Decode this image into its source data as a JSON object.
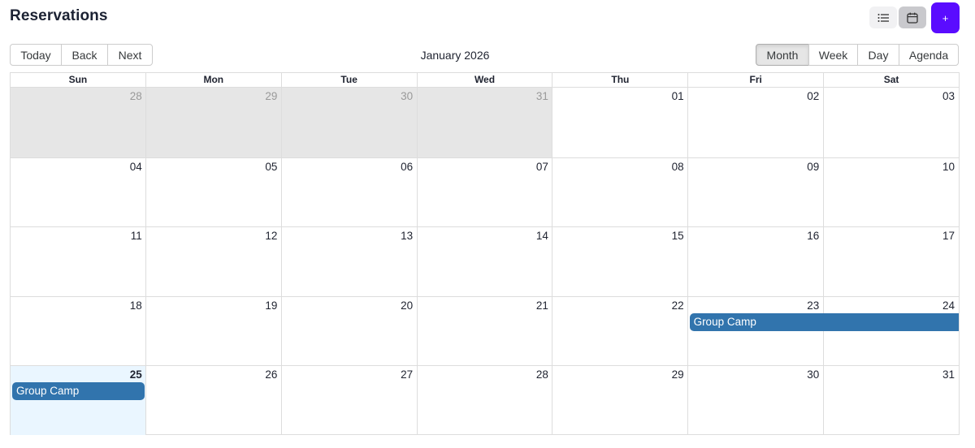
{
  "header": {
    "title": "Reservations",
    "list_view_icon": "list-icon",
    "calendar_view_icon": "calendar-icon",
    "add_label": "+"
  },
  "toolbar": {
    "nav": [
      "Today",
      "Back",
      "Next"
    ],
    "label": "January 2026",
    "views": [
      "Month",
      "Week",
      "Day",
      "Agenda"
    ],
    "active_view": "Month"
  },
  "calendar": {
    "weekdays": [
      "Sun",
      "Mon",
      "Tue",
      "Wed",
      "Thu",
      "Fri",
      "Sat"
    ],
    "weeks": [
      {
        "dates": [
          "28",
          "29",
          "30",
          "31",
          "01",
          "02",
          "03"
        ],
        "off_range": [
          true,
          true,
          true,
          true,
          false,
          false,
          false
        ]
      },
      {
        "dates": [
          "04",
          "05",
          "06",
          "07",
          "08",
          "09",
          "10"
        ],
        "off_range": [
          false,
          false,
          false,
          false,
          false,
          false,
          false
        ]
      },
      {
        "dates": [
          "11",
          "12",
          "13",
          "14",
          "15",
          "16",
          "17"
        ],
        "off_range": [
          false,
          false,
          false,
          false,
          false,
          false,
          false
        ]
      },
      {
        "dates": [
          "18",
          "19",
          "20",
          "21",
          "22",
          "23",
          "24"
        ],
        "off_range": [
          false,
          false,
          false,
          false,
          false,
          false,
          false
        ]
      },
      {
        "dates": [
          "25",
          "26",
          "27",
          "28",
          "29",
          "30",
          "31"
        ],
        "off_range": [
          false,
          false,
          false,
          false,
          false,
          false,
          false
        ]
      }
    ],
    "today": "25",
    "events": [
      {
        "title": "Group Camp",
        "start": "2026-01-23",
        "end": "2026-01-25"
      },
      {
        "title": "Group Camp",
        "start": "2026-01-25",
        "end": "2026-01-25"
      }
    ]
  },
  "colors": {
    "accent": "#5a0cff",
    "event": "#3174ad",
    "off_range": "#e6e6e6",
    "today": "#eaf6ff"
  }
}
